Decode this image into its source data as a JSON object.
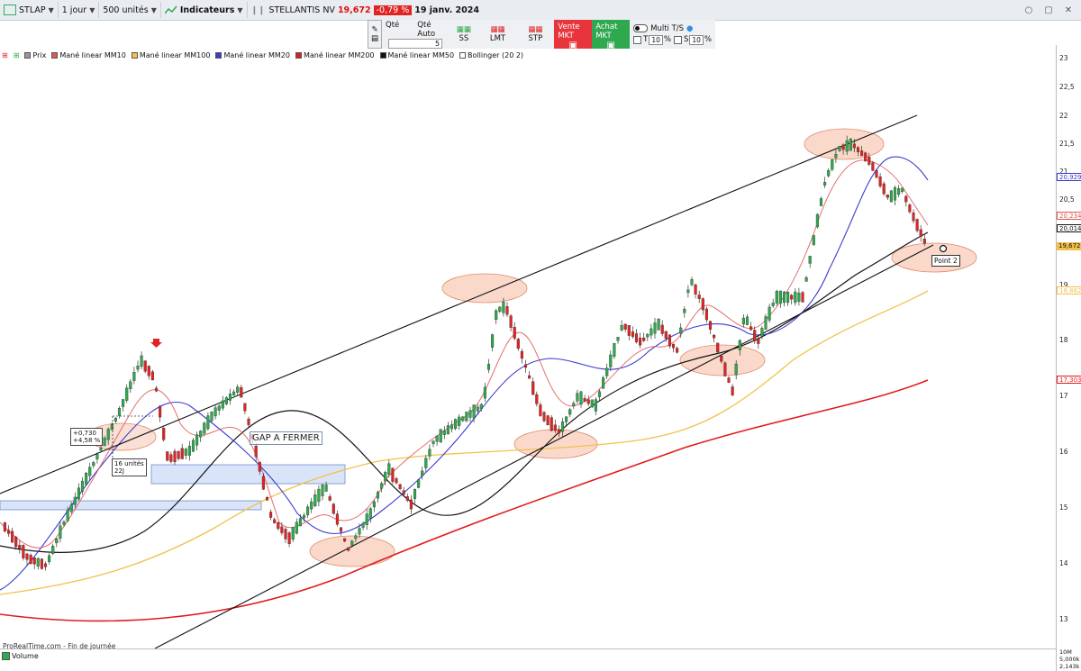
{
  "toolbar": {
    "symbol": "STLAP",
    "period": "1 jour",
    "units": "500 unités",
    "indicators": "Indicateurs",
    "instrument_name": "STELLANTIS NV",
    "price": "19,672",
    "change_pct": "-0,79 %",
    "date": "19 janv. 2024"
  },
  "order_panel": {
    "qty_label": "Qté",
    "qty_auto_label": "Qté Auto",
    "qty_value": "5",
    "ss_label": "SS",
    "lmt_label": "LMT",
    "stp_label": "STP",
    "sell_label": "Vente MKT",
    "buy_label": "Achat MKT",
    "multi_label": "Multi T/S",
    "t_label": "T",
    "t_value": "10",
    "s_label": "S",
    "s_value": "10",
    "pct": "%"
  },
  "legend": [
    {
      "label": "Prix",
      "color": "#777777"
    },
    {
      "label": "Mané linear MM10",
      "color": "#e05555"
    },
    {
      "label": "Mané linear MM100",
      "color": "#f2c14e"
    },
    {
      "label": "Mané linear MM20",
      "color": "#3b3bd1"
    },
    {
      "label": "Mané linear MM200",
      "color": "#e21b1b"
    },
    {
      "label": "Mané linear MM50",
      "color": "#111111"
    },
    {
      "label": "Bollinger (20 2)",
      "color": "#ffffff"
    }
  ],
  "yaxis": {
    "ticks": [
      "23",
      "22,5",
      "22",
      "21,5",
      "21",
      "20,5",
      "20",
      "19",
      "18",
      "17",
      "16",
      "15",
      "14",
      "13"
    ],
    "tags": [
      {
        "text": "20,929",
        "color": "#3b3bd1",
        "bg": "#ffffff"
      },
      {
        "text": "20,234",
        "color": "#e05555",
        "bg": "#ffffff"
      },
      {
        "text": "20,014",
        "color": "#111111",
        "bg": "#ffffff"
      },
      {
        "text": "19,672",
        "color": "#111111",
        "bg": "#f2c14e"
      },
      {
        "text": "18,882",
        "color": "#f2c14e",
        "bg": "#ffffff"
      },
      {
        "text": "17,303",
        "color": "#e21b1b",
        "bg": "#ffffff"
      }
    ]
  },
  "annotations": {
    "gap_label": "GAP A FERMER",
    "point_label": "Point 2",
    "measure_1": "+0,730",
    "measure_2": "+4,58 %",
    "units_1": "16 unités",
    "units_2": "22J"
  },
  "footer": {
    "source": "ProRealTime.com - Fin de journée",
    "volume_label": "Volume",
    "vol_tick_1": "10M",
    "vol_tick_2": "5,000k",
    "vol_tick_3": "2,143k"
  },
  "colors": {
    "up": "#2fa84f",
    "down": "#e02424",
    "channel": "#111111",
    "ellipse": "#f5b9a0",
    "gap_zone": "#c9d9f5"
  }
}
